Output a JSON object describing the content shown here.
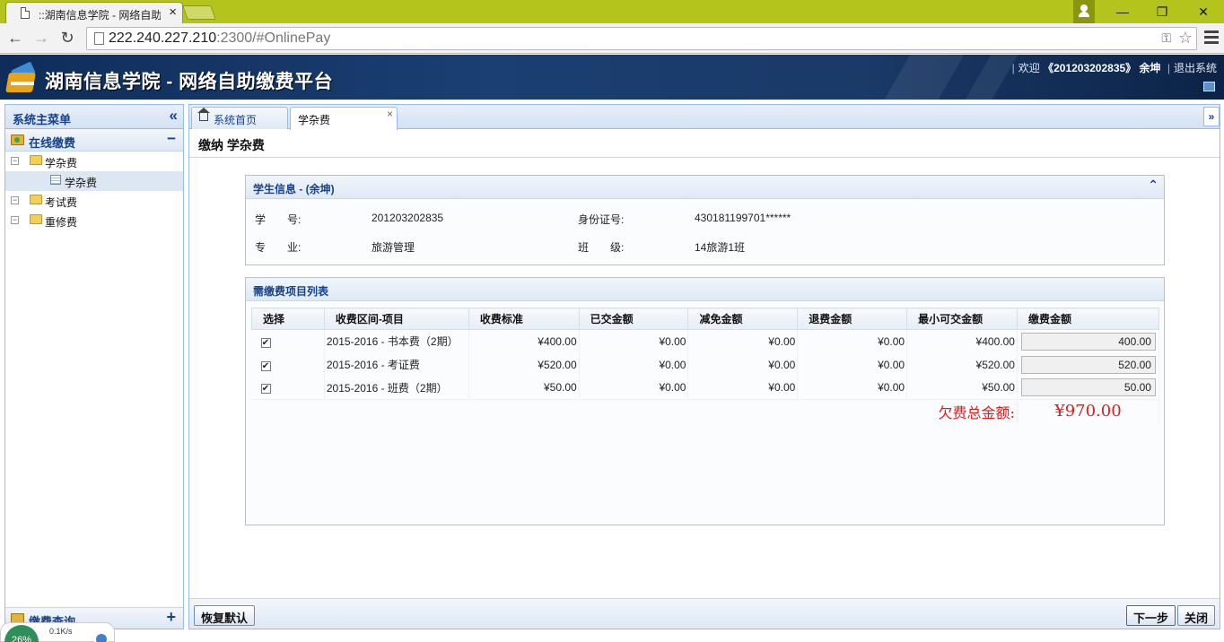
{
  "browser": {
    "tab_title": "::湖南信息学院 - 网络自助缴费平台",
    "url_host": "222.240.227.210",
    "url_rest": ":2300/#OnlinePay",
    "window_minimize": "—",
    "window_restore": "❐",
    "window_close": "✕"
  },
  "app": {
    "title": "湖南信息学院 - 网络自助缴费平台",
    "welcome": "欢迎",
    "user_id": "《201203202835》 余坤",
    "logout": "退出系统"
  },
  "sidebar": {
    "title": "系统主菜单",
    "section": "在线缴费",
    "tree": [
      {
        "label": "学杂费",
        "expand": "−"
      },
      {
        "label": "学杂费"
      },
      {
        "label": "考试费",
        "expand": "−"
      },
      {
        "label": "重修费",
        "expand": "−"
      }
    ],
    "footer_section": "缴费查询"
  },
  "net_widget": {
    "percent": "26%",
    "speed": "0.1K/s"
  },
  "main": {
    "tabs": [
      {
        "label": "系统首页"
      },
      {
        "label": "学杂费",
        "close": "×"
      }
    ],
    "page_title": "缴纳 学杂费",
    "student": {
      "header": "学生信息 - (余坤)",
      "student_no_label": "学　　号:",
      "student_no": "201203202835",
      "id_label": "身份证号:",
      "id_value": "430181199701******",
      "major_label": "专　　业:",
      "major": "旅游管理",
      "class_label": "班　　级:",
      "class_value": "14旅游1班"
    },
    "fees": {
      "header": "需缴费项目列表",
      "columns": [
        "选择",
        "收费区间-项目",
        "收费标准",
        "已交金额",
        "减免金额",
        "退费金额",
        "最小可交金额",
        "缴费金额"
      ],
      "rows": [
        {
          "checked": true,
          "item": "2015-2016 - 书本费（2期）",
          "standard": "¥400.00",
          "paid": "¥0.00",
          "waived": "¥0.00",
          "refund": "¥0.00",
          "min": "¥400.00",
          "amount": "400.00"
        },
        {
          "checked": true,
          "item": "2015-2016 - 考证费",
          "standard": "¥520.00",
          "paid": "¥0.00",
          "waived": "¥0.00",
          "refund": "¥0.00",
          "min": "¥520.00",
          "amount": "520.00"
        },
        {
          "checked": true,
          "item": "2015-2016 - 班费（2期）",
          "standard": "¥50.00",
          "paid": "¥0.00",
          "waived": "¥0.00",
          "refund": "¥0.00",
          "min": "¥50.00",
          "amount": "50.00"
        }
      ],
      "total_label": "欠费总金额:",
      "total_value": "¥970.00"
    },
    "buttons": {
      "reset": "恢复默认",
      "next": "下一步",
      "close": "关闭"
    }
  }
}
